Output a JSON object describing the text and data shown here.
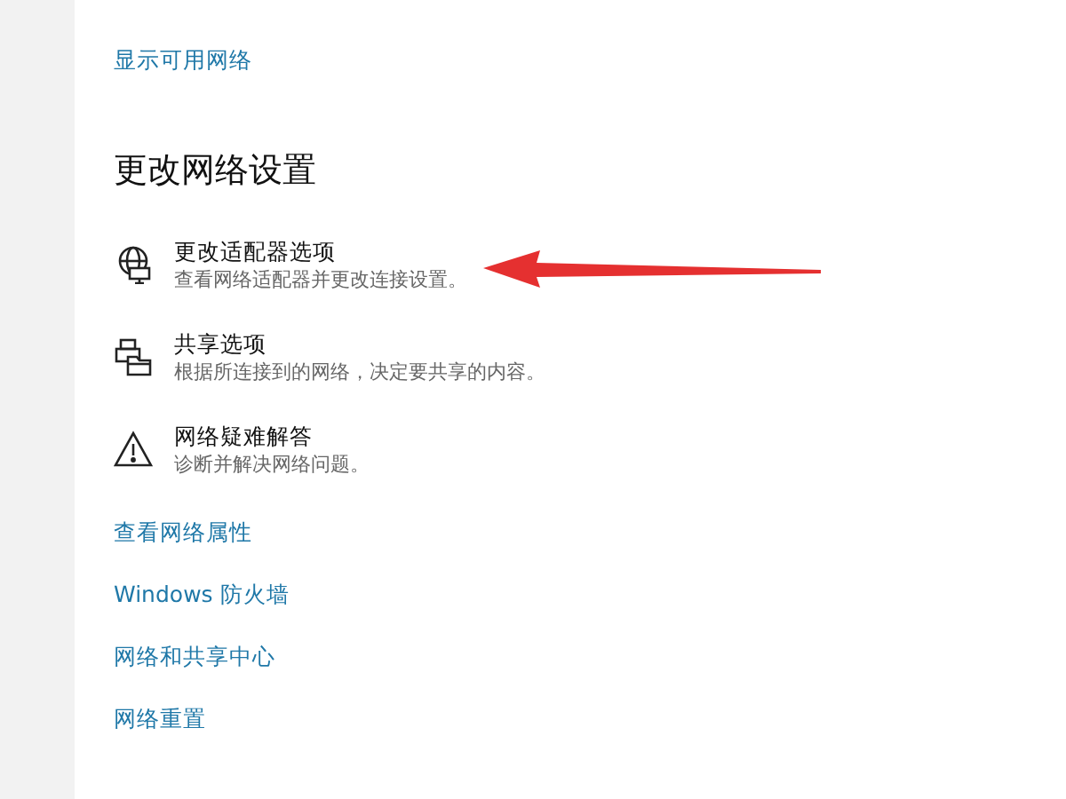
{
  "top_link": "显示可用网络",
  "section_title": "更改网络设置",
  "options": [
    {
      "kind": "adapter",
      "title": "更改适配器选项",
      "description": "查看网络适配器并更改连接设置。"
    },
    {
      "kind": "sharing",
      "title": "共享选项",
      "description": "根据所连接到的网络，决定要共享的内容。"
    },
    {
      "kind": "troubleshoot",
      "title": "网络疑难解答",
      "description": "诊断并解决网络问题。"
    }
  ],
  "links": [
    "查看网络属性",
    "Windows 防火墙",
    "网络和共享中心",
    "网络重置"
  ]
}
